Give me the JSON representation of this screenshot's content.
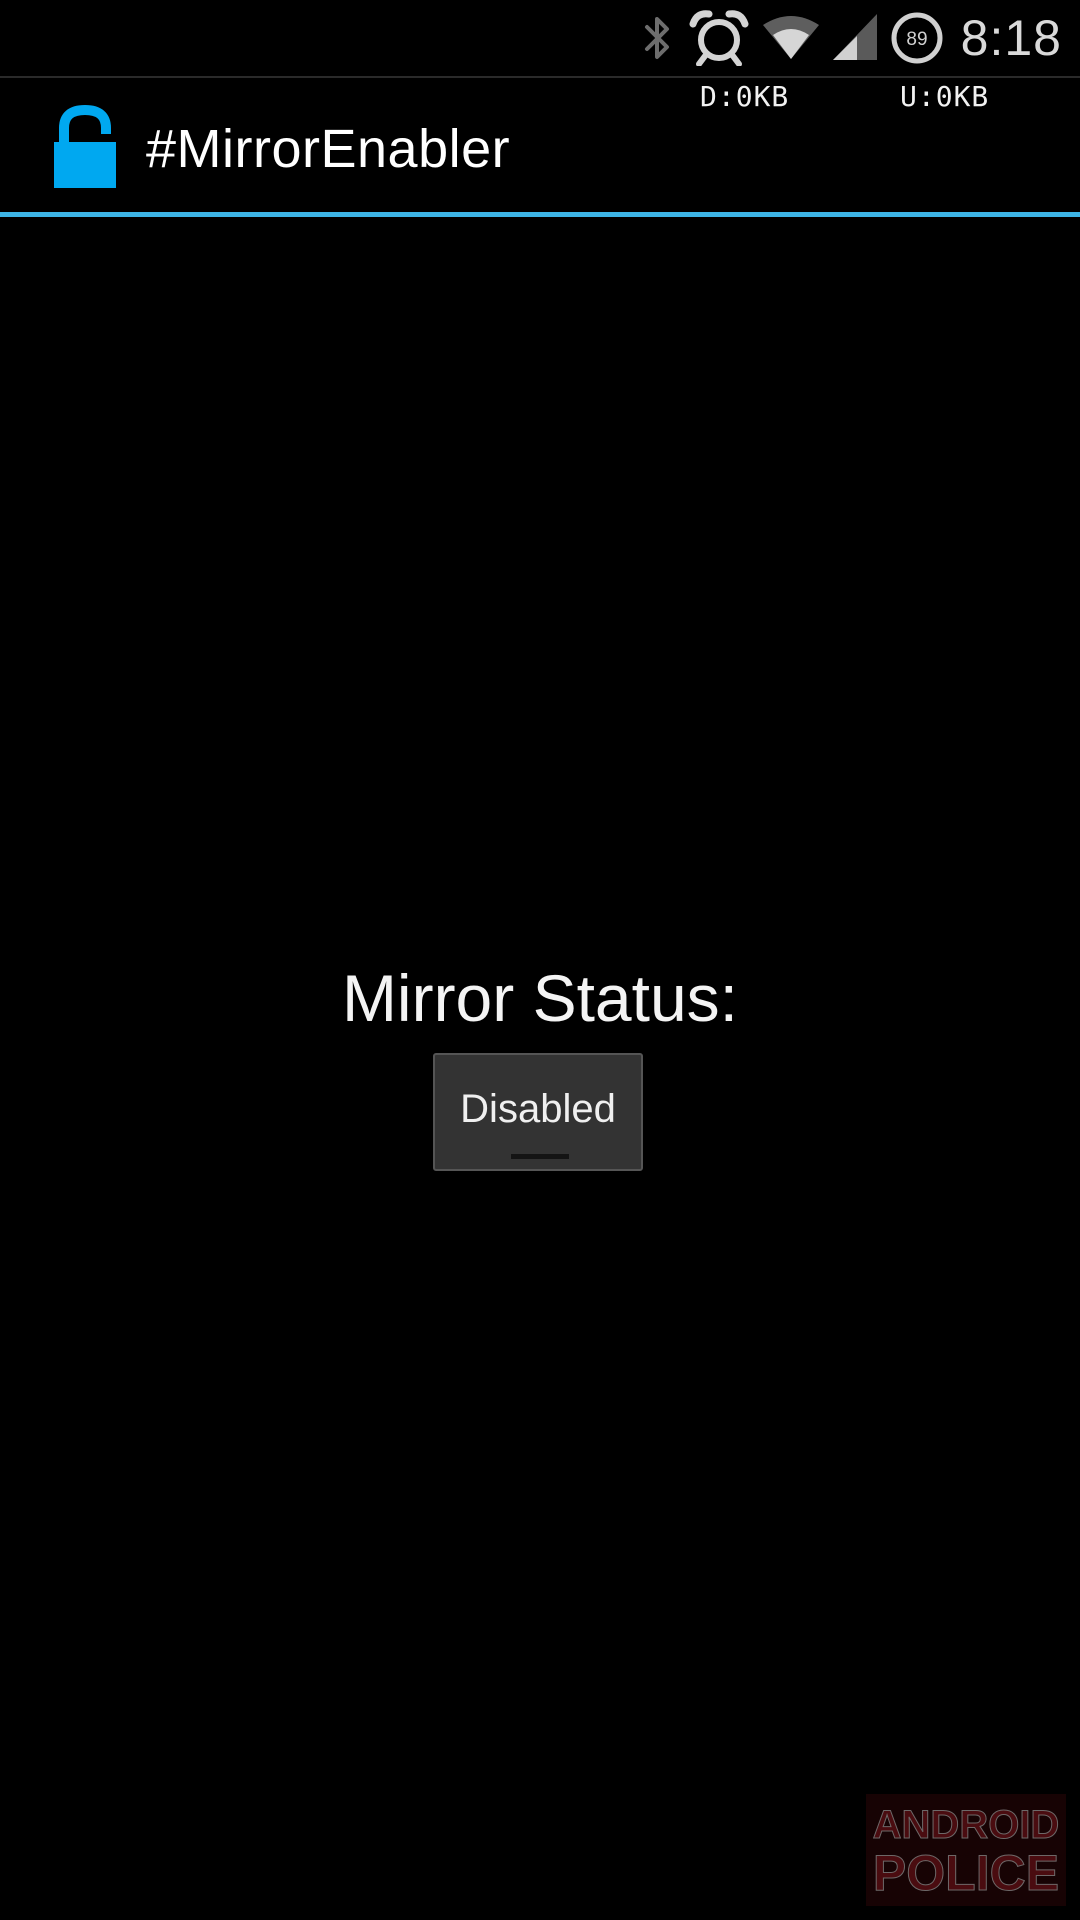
{
  "status_bar": {
    "time": "8:18",
    "battery_level": "89",
    "icons": [
      "bluetooth-icon",
      "alarm-icon",
      "wifi-icon",
      "cell-signal-icon",
      "battery-icon"
    ]
  },
  "traffic": {
    "download": "D:0KB",
    "upload": "U:0KB"
  },
  "action_bar": {
    "title": "#MirrorEnabler",
    "icon": "unlocked-padlock-icon",
    "accent_color": "#3db5e6",
    "icon_color": "#00a8f0"
  },
  "main": {
    "status_label": "Mirror Status:",
    "toggle_label": "Disabled"
  },
  "watermark": {
    "text_line1": "ANDROID",
    "text_line2": "POLICE"
  }
}
